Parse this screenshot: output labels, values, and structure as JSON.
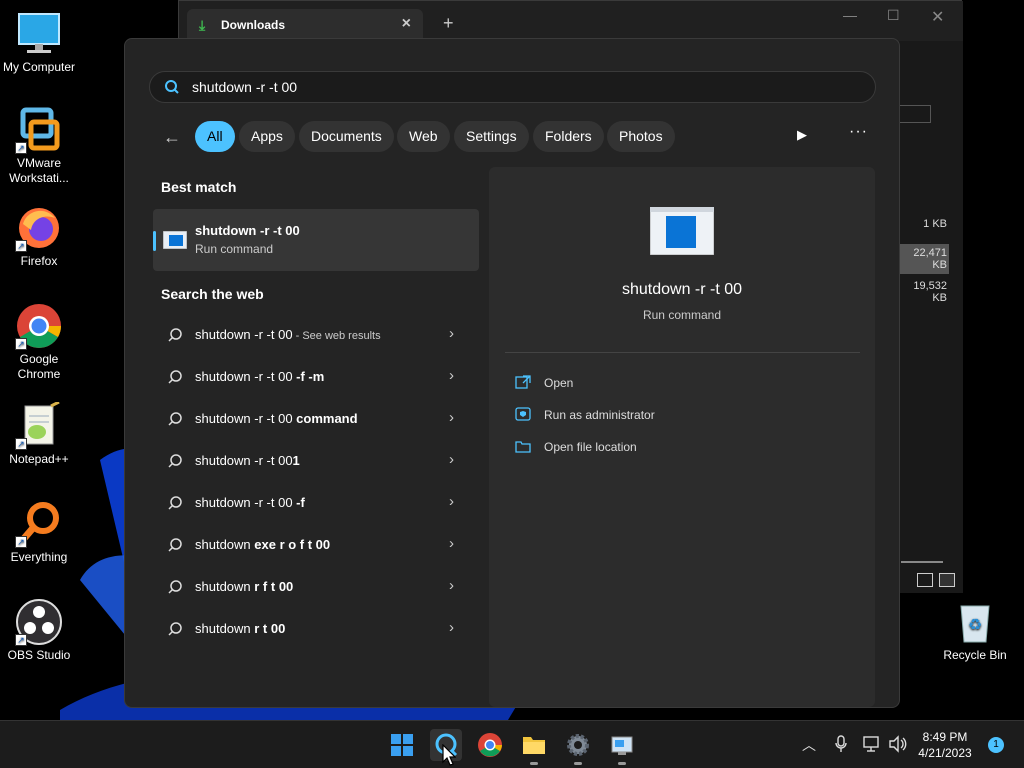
{
  "desktop": {
    "icons": [
      {
        "label": "My Computer",
        "icon": "monitor-icon"
      },
      {
        "label": "VMware Workstati...",
        "icon": "vmware-icon"
      },
      {
        "label": "Firefox",
        "icon": "firefox-icon"
      },
      {
        "label": "Google Chrome",
        "icon": "chrome-icon"
      },
      {
        "label": "Notepad++",
        "icon": "notepadpp-icon"
      },
      {
        "label": "Everything",
        "icon": "everything-icon"
      },
      {
        "label": "OBS Studio",
        "icon": "obs-icon"
      },
      {
        "label": "Recycle Bin",
        "icon": "recycle-bin-icon"
      }
    ]
  },
  "explorer": {
    "tab_title": "Downloads",
    "sizes": [
      "1 KB",
      "22,471 KB",
      "19,532 KB"
    ]
  },
  "search": {
    "query": "shutdown -r  -t 00",
    "filters": [
      "All",
      "Apps",
      "Documents",
      "Web",
      "Settings",
      "Folders",
      "Photos"
    ],
    "active_filter": "All",
    "best_match_heading": "Best match",
    "best_match": {
      "title": "shutdown -r -t 00",
      "subtitle": "Run command"
    },
    "web_heading": "Search the web",
    "web_results": [
      {
        "base": "shutdown -r -t 00",
        "bold": "",
        "suffix": " - See web results"
      },
      {
        "base": "shutdown -r -t 00 ",
        "bold": "-f -m",
        "suffix": ""
      },
      {
        "base": "shutdown -r -t 00 ",
        "bold": "command",
        "suffix": ""
      },
      {
        "base": "shutdown -r -t 00",
        "bold": "1",
        "suffix": ""
      },
      {
        "base": "shutdown -r -t 00 ",
        "bold": "-f",
        "suffix": ""
      },
      {
        "base": "shutdown ",
        "bold": "exe r o f t 00",
        "suffix": ""
      },
      {
        "base": "shutdown ",
        "bold": "r f t 00",
        "suffix": ""
      },
      {
        "base": "shutdown ",
        "bold": "r t 00",
        "suffix": ""
      }
    ],
    "preview": {
      "title": "shutdown -r -t 00",
      "subtitle": "Run command",
      "actions": [
        {
          "label": "Open",
          "icon": "open-external-icon"
        },
        {
          "label": "Run as administrator",
          "icon": "shield-admin-icon"
        },
        {
          "label": "Open file location",
          "icon": "folder-icon"
        }
      ]
    }
  },
  "taskbar": {
    "time": "8:49 PM",
    "date": "4/21/2023",
    "notification_count": "1",
    "apps": [
      "windows-start-icon",
      "search-icon",
      "chrome-icon",
      "file-explorer-icon",
      "settings-icon",
      "control-panel-icon"
    ]
  },
  "colors": {
    "accent": "#4cc2ff",
    "panel": "#242424",
    "preview": "#2c2c2c"
  }
}
